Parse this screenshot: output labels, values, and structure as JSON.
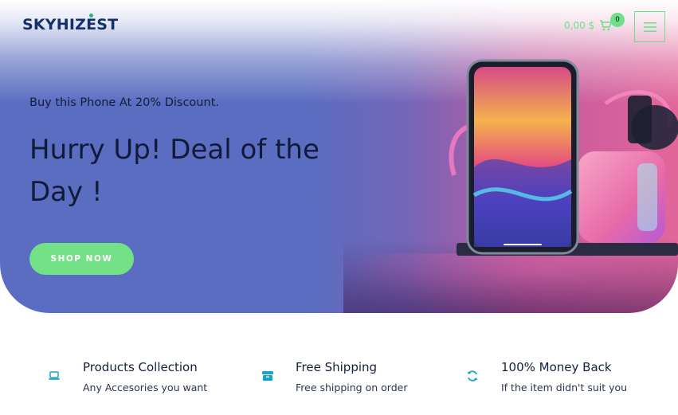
{
  "brand": {
    "name": "SKYHIZEST"
  },
  "header": {
    "cart_amount": "0,00 $",
    "cart_count": "0",
    "icons": {
      "cart": "cart-icon",
      "menu": "hamburger-menu-icon"
    },
    "accent_color": "#6ee08b"
  },
  "hero": {
    "subheading": "Buy this Phone At 20% Discount.",
    "headline": "Hurry Up! Deal of the Day !",
    "cta_label": "SHOP NOW",
    "image": "phone-with-earbuds-and-smartwatch-on-charging-stand",
    "colors": {
      "gradient_start": "#5a6dc0",
      "gradient_end": "#e2669a",
      "cta": "#73e185"
    }
  },
  "features": [
    {
      "icon": "laptop-icon",
      "title": "Products Collection",
      "description": "Any Accesories you want"
    },
    {
      "icon": "box-icon",
      "title": "Free Shipping",
      "description": "Free shipping on order"
    },
    {
      "icon": "refresh-icon",
      "title": "100% Money Back",
      "description": "If the item didn't suit you"
    }
  ],
  "feature_icon_color": "#1aa3c9"
}
